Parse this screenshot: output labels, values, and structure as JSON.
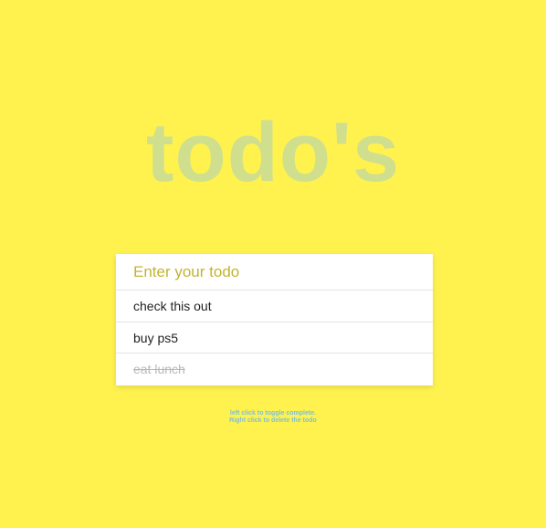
{
  "header": {
    "title": "todo's"
  },
  "input": {
    "placeholder": "Enter your todo",
    "value": ""
  },
  "todos": [
    {
      "text": "check this out",
      "completed": false
    },
    {
      "text": "buy ps5",
      "completed": false
    },
    {
      "text": "eat lunch",
      "completed": true
    }
  ],
  "hint": {
    "line1": "left click to toggle complete.",
    "line2": "Right click to delete the todo"
  },
  "colors": {
    "background": "#fff24f",
    "title": "#cfdf8e",
    "placeholder": "#c2b52e",
    "completed_text": "#b9b9b9",
    "hint_text": "#7fbfd6"
  }
}
